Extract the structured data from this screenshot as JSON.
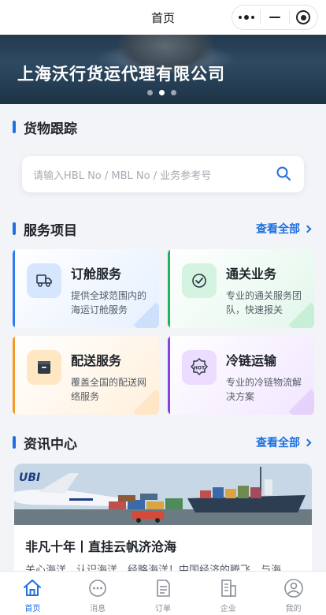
{
  "navbar": {
    "title": "首页"
  },
  "banner": {
    "title": "上海沃行货运代理有限公司",
    "slides": 3,
    "active_slide": 2
  },
  "tracking": {
    "title": "货物跟踪",
    "search_placeholder": "请输入HBL No / MBL No / 业务参考号"
  },
  "services": {
    "title": "服务项目",
    "view_all": "查看全部",
    "items": [
      {
        "title": "订舱服务",
        "desc": "提供全球范围内的海运订舱服务",
        "icon": "truck-icon",
        "color": "#2f7cf0"
      },
      {
        "title": "通关业务",
        "desc": "专业的通关服务团队，快速报关",
        "icon": "check-circle-icon",
        "color": "#21b35e"
      },
      {
        "title": "配送服务",
        "desc": "覆盖全国的配送网络服务",
        "icon": "package-icon",
        "color": "#f59a23"
      },
      {
        "title": "冷链运输",
        "desc": "专业的冷链物流解决方案",
        "icon": "hot-badge-icon",
        "color": "#8a3fe0"
      }
    ]
  },
  "news": {
    "title": "资讯中心",
    "view_all": "查看全部",
    "items": [
      {
        "title": "非凡十年丨直挂云帆济沧海",
        "summary": "关心海洋、认识海洋、经略海洋！中国经济的腾飞，与海"
      }
    ]
  },
  "tabbar": {
    "items": [
      {
        "label": "首页",
        "icon": "home-icon",
        "active": true
      },
      {
        "label": "消息",
        "icon": "message-icon",
        "active": false
      },
      {
        "label": "订单",
        "icon": "order-icon",
        "active": false
      },
      {
        "label": "企业",
        "icon": "building-icon",
        "active": false
      },
      {
        "label": "我的",
        "icon": "user-icon",
        "active": false
      }
    ]
  },
  "colors": {
    "accent": "#1f6fe0",
    "background": "#f2f4f8"
  }
}
